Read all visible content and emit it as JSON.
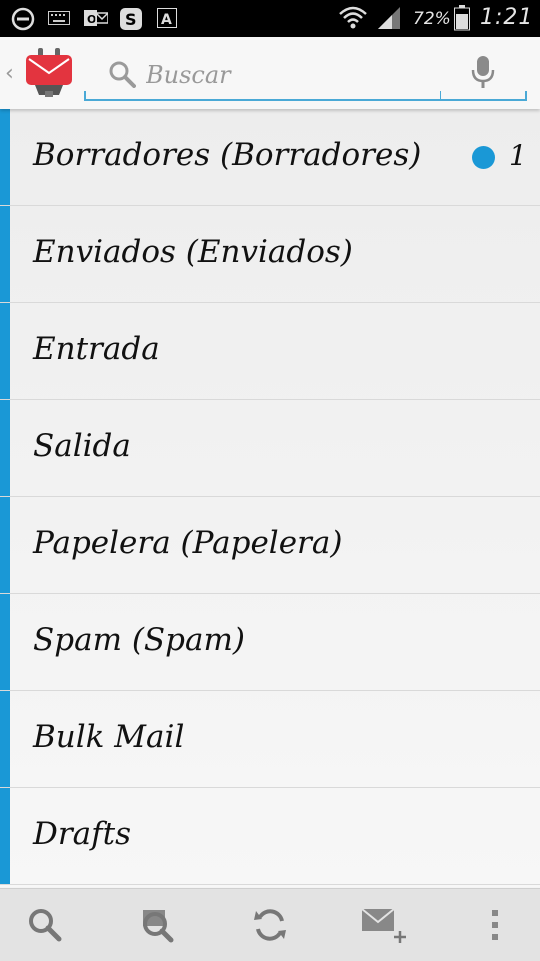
{
  "status_bar": {
    "battery_percent": "72%",
    "time": "1:21",
    "icons": [
      "do-not-disturb-icon",
      "keyboard-icon",
      "outlook-icon",
      "sync-app-icon",
      "font-app-icon",
      "wifi-icon",
      "cell-signal-icon",
      "battery-icon"
    ]
  },
  "search": {
    "placeholder": "Buscar",
    "value": ""
  },
  "folders": [
    {
      "label": "Borradores (Borradores)",
      "unread": "1"
    },
    {
      "label": "Enviados (Enviados)"
    },
    {
      "label": "Entrada"
    },
    {
      "label": "Salida"
    },
    {
      "label": "Papelera (Papelera)"
    },
    {
      "label": "Spam (Spam)"
    },
    {
      "label": "Bulk Mail"
    },
    {
      "label": "Drafts"
    }
  ],
  "bottom_bar": {
    "buttons": [
      "search-icon",
      "search-messages-icon",
      "refresh-icon",
      "compose-icon",
      "overflow-menu-icon"
    ]
  },
  "colors": {
    "accent": "#1a98d6",
    "logo_red": "#e3343f",
    "status_bar": "#000000"
  }
}
